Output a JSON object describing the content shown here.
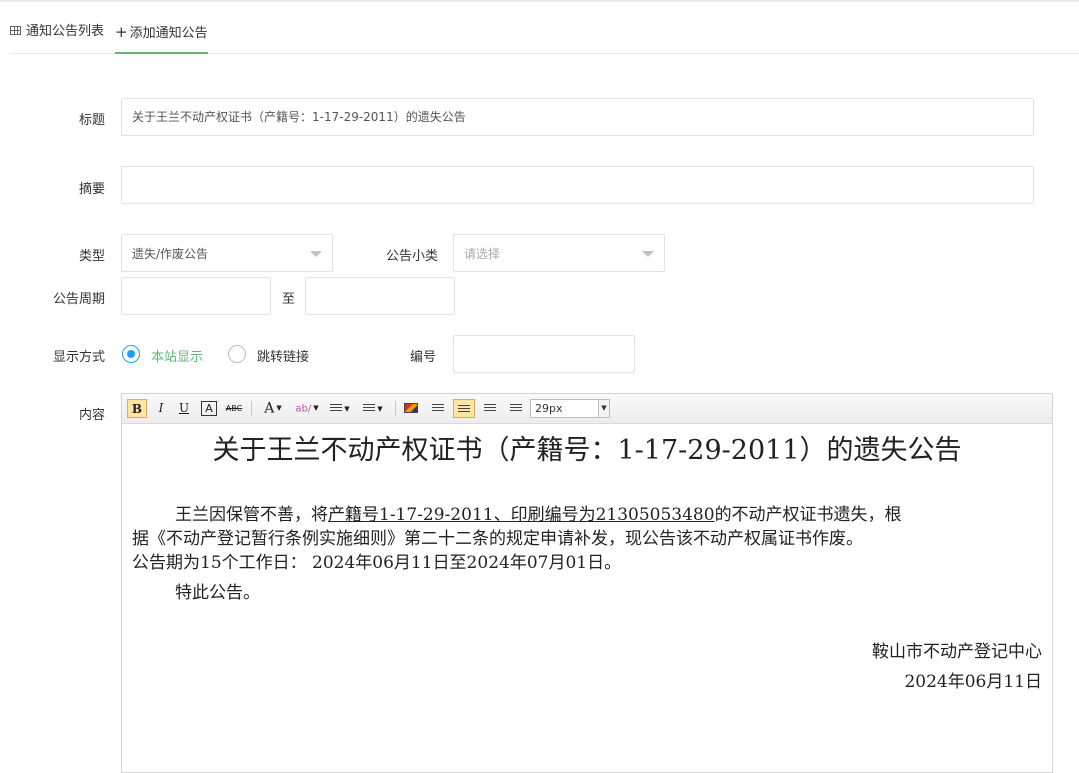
{
  "tabs": [
    {
      "label": "通知公告列表",
      "icon": "table-icon"
    },
    {
      "label": "添加通知公告",
      "icon": "plus-icon",
      "active": true
    }
  ],
  "form": {
    "title_label": "标题",
    "title_value": "关于王兰不动产权证书（产籍号：1-17-29-2011）的遗失公告",
    "summary_label": "摘要",
    "summary_value": "",
    "type_label": "类型",
    "type_value": "遗失/作废公告",
    "subtype_label": "公告小类",
    "subtype_placeholder": "请选择",
    "period_label": "公告周期",
    "period_to": "至",
    "display_label": "显示方式",
    "display_options": [
      "本站显示",
      "跳转链接"
    ],
    "number_label": "编号",
    "content_label": "内容"
  },
  "toolbar": {
    "bold": "B",
    "italic": "I",
    "underline": "U",
    "border_a": "A",
    "strike": "ABC",
    "font_color": "A",
    "fontsize": "29px"
  },
  "document": {
    "title": "关于王兰不动产权证书（产籍号：1-17-29-2011）的遗失公告",
    "p1_a": "王兰因保管不善，将",
    "p1_u": "产籍号1-17-29-2011、印刷编号为21305053480",
    "p1_b": "的不动产权证书遗失，根",
    "p2": "据《不动产登记暂行条例实施细则》第二十二条的规定申请补发，现公告该不动产权属证书作废。",
    "p3": "公告期为15个工作日：  2024年06月11日至2024年07月01日。",
    "p4": "特此公告。",
    "sign_org": "鞍山市不动产登记中心",
    "sign_date": "2024年06月11日"
  },
  "colors": {
    "accent": "#5fb878",
    "radio": "#1e9fff"
  }
}
